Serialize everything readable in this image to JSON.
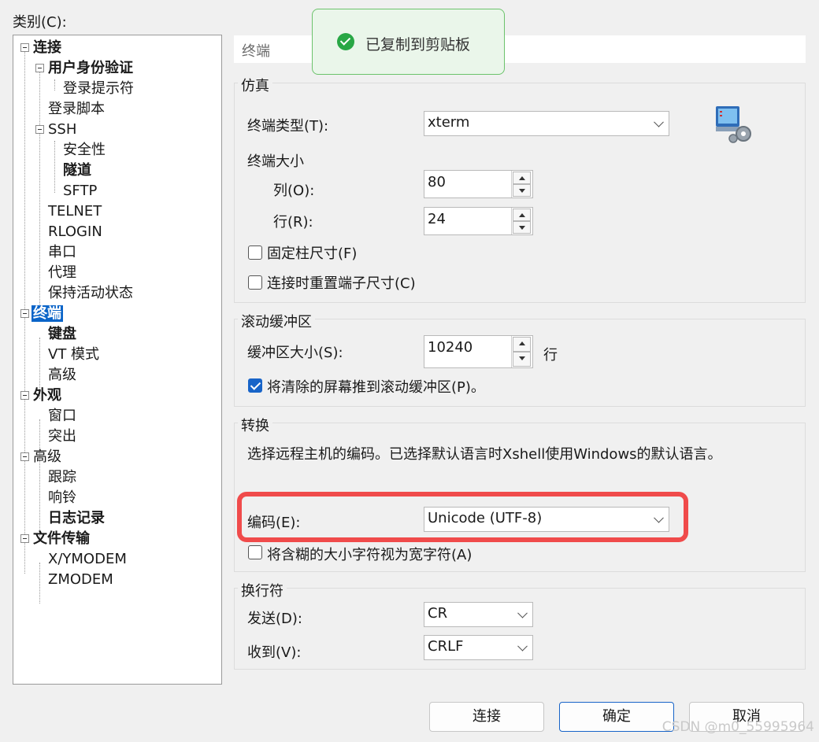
{
  "category_label": "类别(C):",
  "tree": [
    {
      "label": "连接",
      "bold": true
    },
    {
      "label": "用户身份验证",
      "bold": true
    },
    {
      "label": "登录提示符",
      "bold": false
    },
    {
      "label": "登录脚本",
      "bold": false
    },
    {
      "label": "SSH",
      "bold": false
    },
    {
      "label": "安全性",
      "bold": false
    },
    {
      "label": "隧道",
      "bold": true
    },
    {
      "label": "SFTP",
      "bold": false
    },
    {
      "label": "TELNET",
      "bold": false
    },
    {
      "label": "RLOGIN",
      "bold": false
    },
    {
      "label": "串口",
      "bold": false
    },
    {
      "label": "代理",
      "bold": false
    },
    {
      "label": "保持活动状态",
      "bold": false
    },
    {
      "label": "终端",
      "bold": true,
      "selected": true
    },
    {
      "label": "键盘",
      "bold": true
    },
    {
      "label": "VT 模式",
      "bold": false
    },
    {
      "label": "高级",
      "bold": false
    },
    {
      "label": "外观",
      "bold": true
    },
    {
      "label": "窗口",
      "bold": false
    },
    {
      "label": "突出",
      "bold": false
    },
    {
      "label": "高级",
      "bold": false
    },
    {
      "label": "跟踪",
      "bold": false
    },
    {
      "label": "响铃",
      "bold": false
    },
    {
      "label": "日志记录",
      "bold": true
    },
    {
      "label": "文件传输",
      "bold": true
    },
    {
      "label": "X/YMODEM",
      "bold": false
    },
    {
      "label": "ZMODEM",
      "bold": false
    }
  ],
  "panel_title": "终端",
  "emulation": {
    "title": "仿真",
    "terminal_type_label": "终端类型(T):",
    "terminal_type_value": "xterm",
    "size_label": "终端大小",
    "cols_label": "列(O):",
    "cols_value": "80",
    "rows_label": "行(R):",
    "rows_value": "24",
    "fixed_size_label": "固定柱尺寸(F)",
    "fixed_size_checked": false,
    "reset_on_connect_label": "连接时重置端子尺寸(C)",
    "reset_on_connect_checked": false
  },
  "scrollback": {
    "title": "滚动缓冲区",
    "size_label": "缓冲区大小(S):",
    "size_value": "10240",
    "unit": "行",
    "push_cleared_label": "将清除的屏幕推到滚动缓冲区(P)。",
    "push_cleared_checked": true
  },
  "translation": {
    "title": "转换",
    "description": "选择远程主机的编码。已选择默认语言时Xshell使用Windows的默认语言。",
    "encoding_label": "编码(E):",
    "encoding_value": "Unicode (UTF-8)",
    "ambiguous_label": "将含糊的大小字符视为宽字符(A)",
    "ambiguous_checked": false
  },
  "newline": {
    "title": "换行符",
    "send_label": "发送(D):",
    "send_value": "CR",
    "receive_label": "收到(V):",
    "receive_value": "CRLF"
  },
  "buttons": {
    "connect": "连接",
    "ok": "确定",
    "cancel": "取消"
  },
  "toast": {
    "message": "已复制到剪贴板",
    "icon": "check-circle-icon"
  },
  "watermark": "CSDN @m0_55995964",
  "colors": {
    "selection": "#0a64c8",
    "highlight": "#f04b4b",
    "toast_border": "#6cc36c",
    "check": "#28a745"
  }
}
